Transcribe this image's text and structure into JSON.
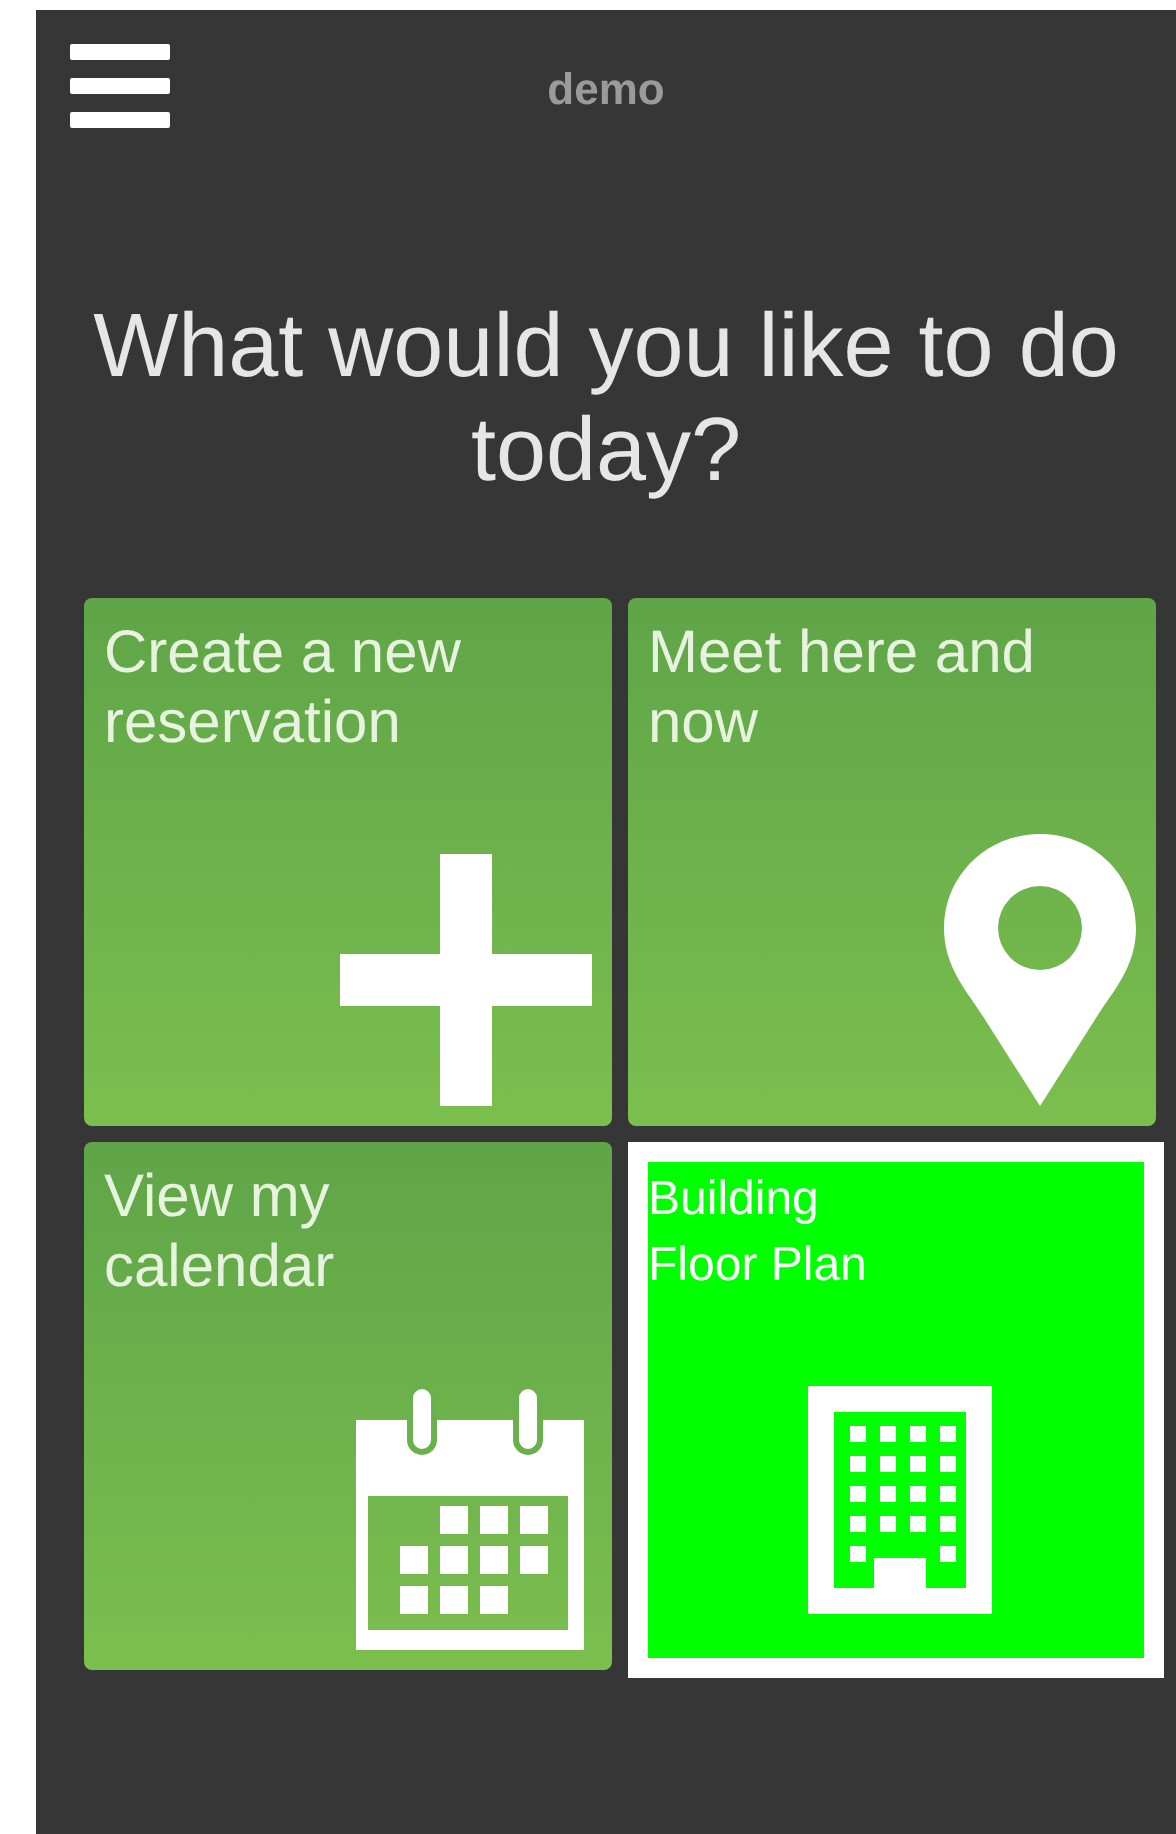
{
  "header": {
    "title": "demo"
  },
  "heading": "What would you like to do today?",
  "tiles": [
    {
      "lines": [
        "Create a new",
        "reservation"
      ],
      "kind": "plus",
      "selected": false
    },
    {
      "lines": [
        "Meet here and",
        "now"
      ],
      "kind": "pin",
      "selected": false
    },
    {
      "lines": [
        "View my",
        "calendar"
      ],
      "kind": "calendar",
      "selected": false
    },
    {
      "lines": [
        "Building",
        "Floor Plan"
      ],
      "kind": "building",
      "selected": true
    }
  ]
}
